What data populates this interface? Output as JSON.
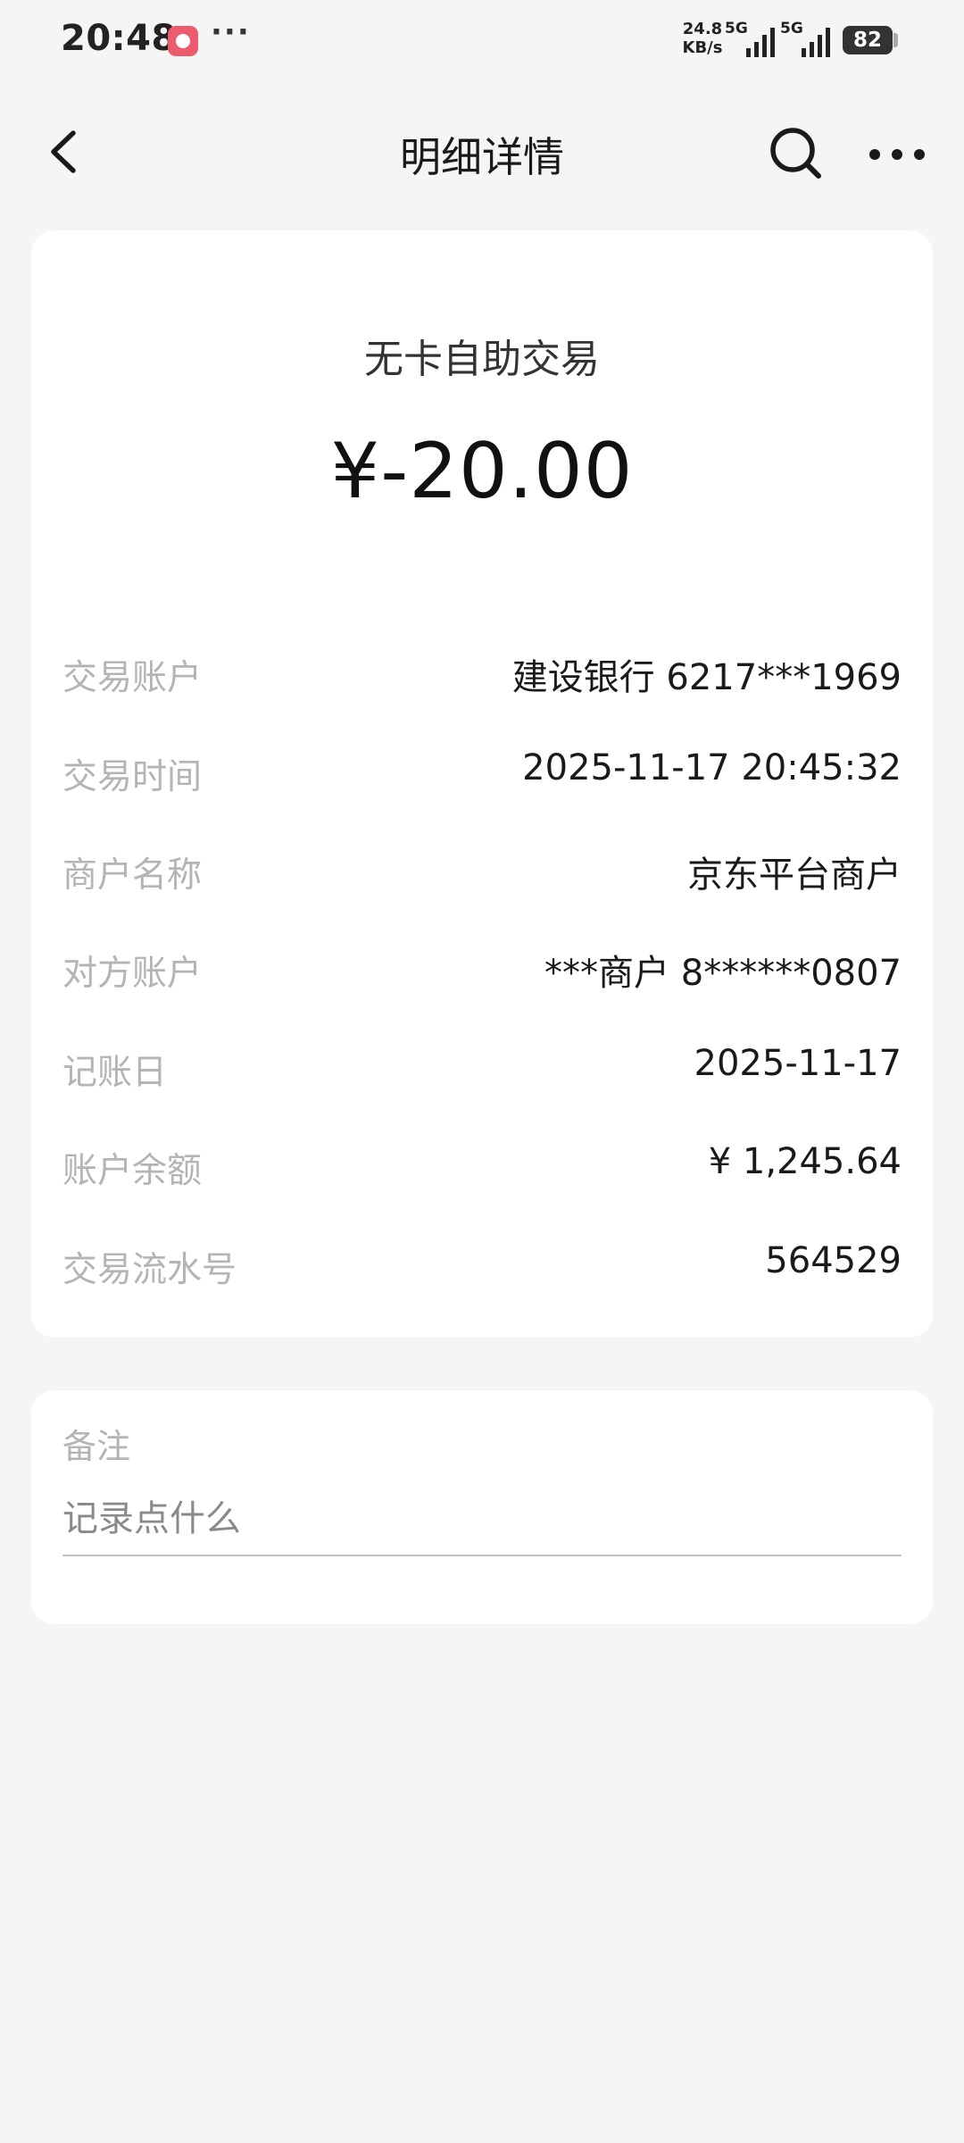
{
  "status_bar": {
    "time": "20:48",
    "more": "···",
    "net_speed_value": "24.8",
    "net_speed_unit": "KB/s",
    "signal1_label": "5G",
    "signal2_label": "5G",
    "battery": "82"
  },
  "nav": {
    "title": "明细详情"
  },
  "transaction": {
    "type": "无卡自助交易",
    "amount": "¥-20.00"
  },
  "details": [
    {
      "label": "交易账户",
      "value": "建设银行 6217***1969"
    },
    {
      "label": "交易时间",
      "value": "2025-11-17 20:45:32"
    },
    {
      "label": "商户名称",
      "value": "京东平台商户"
    },
    {
      "label": "对方账户",
      "value": "***商户 8******0807"
    },
    {
      "label": "记账日",
      "value": "2025-11-17"
    },
    {
      "label": "账户余额",
      "value": "¥ 1,245.64"
    },
    {
      "label": "交易流水号",
      "value": "564529"
    }
  ],
  "note": {
    "label": "备注",
    "placeholder": "记录点什么"
  },
  "colors": {
    "background": "#f5f5f5",
    "card": "#ffffff",
    "label": "#b4b4b4",
    "text": "#1a1a1a",
    "status_app_icon": "#ec5b6e"
  },
  "icons": {
    "back": "chevron-left-icon",
    "search": "search-icon",
    "more": "more-horizontal-icon"
  }
}
